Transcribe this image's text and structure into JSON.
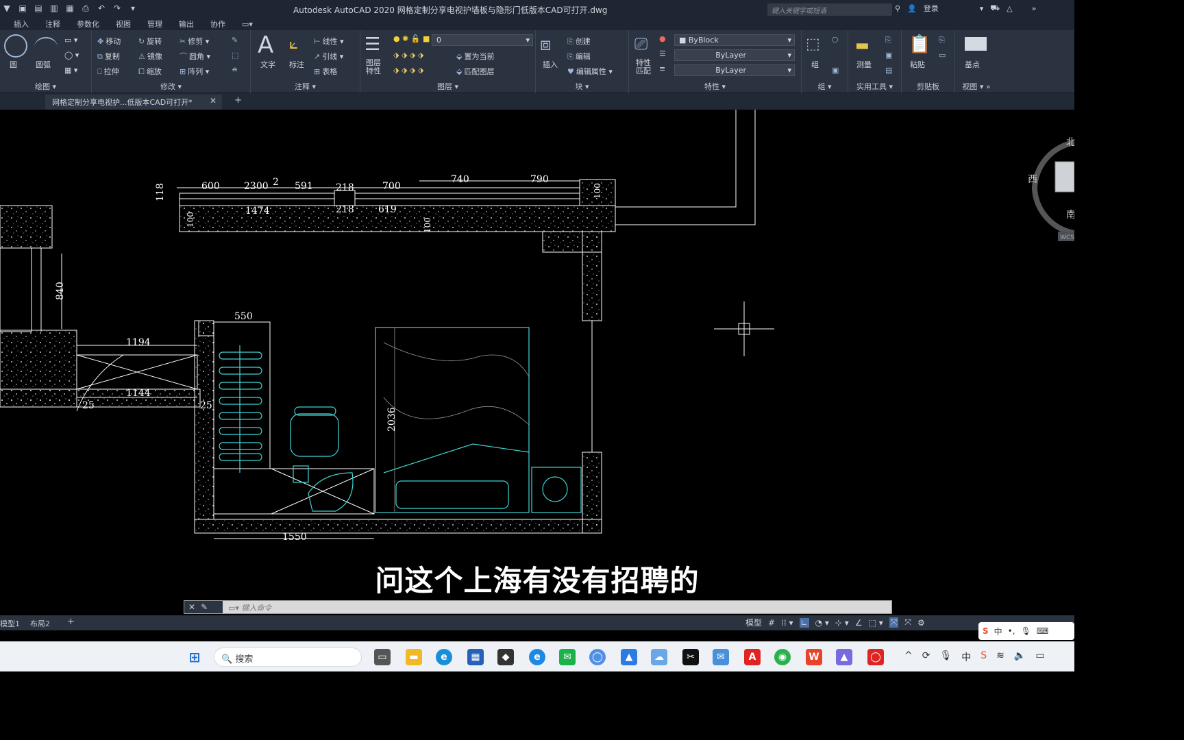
{
  "titlebar": {
    "title": "Autodesk AutoCAD 2020    网格定制分享电视护墙板与隐形门低版本CAD可打开.dwg",
    "search_placeholder": "键入关键字或短语",
    "login": "登录"
  },
  "menu_tabs": [
    "插入",
    "注释",
    "参数化",
    "视图",
    "管理",
    "输出",
    "协作"
  ],
  "ribbon": {
    "draw": {
      "title": "绘图",
      "circle": "圆",
      "arc": "圆弧"
    },
    "modify": {
      "title": "修改",
      "move": "移动",
      "rotate": "旋转",
      "trim": "修剪",
      "copy": "复制",
      "mirror": "镜像",
      "fillet": "圆角",
      "stretch": "拉伸",
      "scale": "缩放",
      "array": "阵列"
    },
    "annotation": {
      "title": "注释",
      "text": "文字",
      "dimension": "标注",
      "linear": "线性",
      "leader": "引线",
      "table": "表格"
    },
    "layers": {
      "title": "图层",
      "properties": "图层特性",
      "layer_value": "0",
      "set_current": "置为当前",
      "match_layer": "匹配图层"
    },
    "block": {
      "title": "块",
      "insert": "插入",
      "create": "创建",
      "edit": "编辑",
      "edit_attr": "编辑属性"
    },
    "properties": {
      "title": "特性",
      "match": "特性匹配",
      "color": "ByBlock",
      "linetype": "ByLayer",
      "lineweight": "ByLayer"
    },
    "groups": {
      "title": "组",
      "group": "组"
    },
    "utilities": {
      "title": "实用工具",
      "measure": "测量"
    },
    "clipboard": {
      "title": "剪贴板",
      "paste": "粘贴"
    },
    "view": {
      "title": "视图",
      "base": "基点"
    }
  },
  "doc_tab": {
    "label": "网格定制分享电视护...低版本CAD可打开*"
  },
  "viewcube": {
    "north": "北",
    "west": "西",
    "south": "南",
    "wcs": "WCS"
  },
  "dimensions": {
    "top_labels": [
      "600",
      "2300",
      "2",
      "591",
      "218",
      "700",
      "740",
      "790"
    ],
    "top_inner": [
      "1474",
      "218",
      "619"
    ],
    "left_118": "118",
    "left_100": "100",
    "mid_100": "100",
    "right_100": "100",
    "d840": "840",
    "d550": "550",
    "d1194": "1194",
    "d1144": "1144",
    "d25a": "25",
    "d25b": "25",
    "d2036": "2036",
    "d1550": "1550"
  },
  "subtitle": "问这个上海有没有招聘的",
  "command": {
    "placeholder": "键入命令"
  },
  "layout_tabs": [
    "模型1",
    "布局2"
  ],
  "status": {
    "model": "模型"
  },
  "taskbar": {
    "search": "搜索"
  },
  "ime": {
    "lang": "中"
  }
}
